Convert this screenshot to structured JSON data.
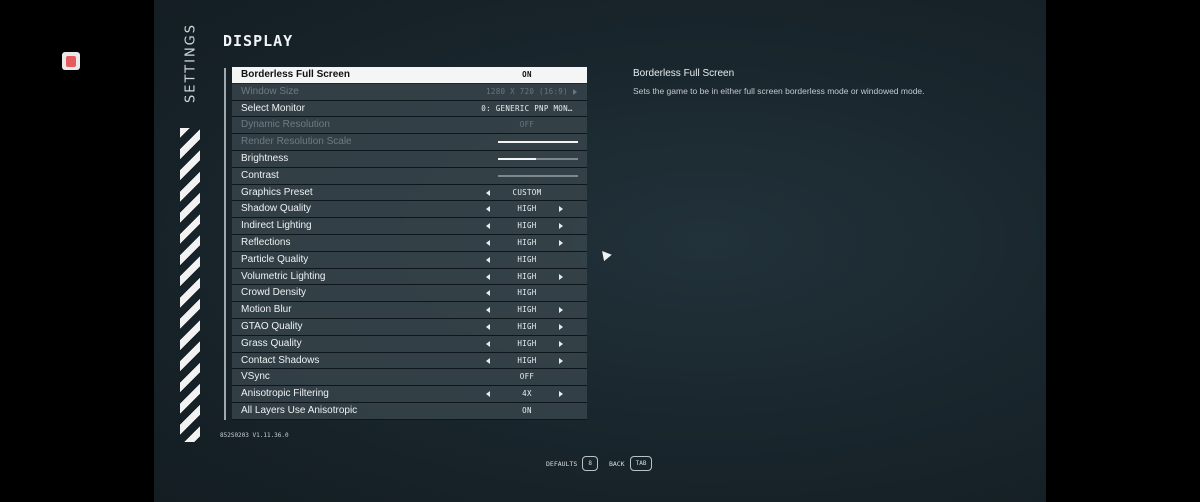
{
  "header": {
    "title": "DISPLAY",
    "section": "SETTINGS"
  },
  "settings": [
    {
      "label": "Borderless Full Screen",
      "value": "ON",
      "kind": "value",
      "state": "selected"
    },
    {
      "label": "Window Size",
      "value": "1280 X 720 (16:9)",
      "kind": "value-right",
      "state": "disabled"
    },
    {
      "label": "Select Monitor",
      "value": "0: GENERIC PNP MON…",
      "kind": "value-wide",
      "state": "normal"
    },
    {
      "label": "Dynamic Resolution",
      "value": "OFF",
      "kind": "value",
      "state": "disabled"
    },
    {
      "label": "Render Resolution Scale",
      "kind": "slider",
      "level": 1.0,
      "state": "disabled"
    },
    {
      "label": "Brightness",
      "kind": "slider",
      "level": 0.47,
      "state": "normal"
    },
    {
      "label": "Contrast",
      "kind": "slider",
      "level": 0.0,
      "state": "normal"
    },
    {
      "label": "Graphics Preset",
      "value": "CUSTOM",
      "kind": "left",
      "state": "normal"
    },
    {
      "label": "Shadow Quality",
      "value": "HIGH",
      "kind": "both",
      "state": "normal"
    },
    {
      "label": "Indirect Lighting",
      "value": "HIGH",
      "kind": "both",
      "state": "normal"
    },
    {
      "label": "Reflections",
      "value": "HIGH",
      "kind": "both",
      "state": "normal"
    },
    {
      "label": "Particle Quality",
      "value": "HIGH",
      "kind": "left",
      "state": "normal"
    },
    {
      "label": "Volumetric Lighting",
      "value": "HIGH",
      "kind": "both",
      "state": "normal"
    },
    {
      "label": "Crowd Density",
      "value": "HIGH",
      "kind": "left",
      "state": "normal"
    },
    {
      "label": "Motion Blur",
      "value": "HIGH",
      "kind": "both",
      "state": "normal"
    },
    {
      "label": "GTAO Quality",
      "value": "HIGH",
      "kind": "both",
      "state": "normal"
    },
    {
      "label": "Grass Quality",
      "value": "HIGH",
      "kind": "both",
      "state": "normal"
    },
    {
      "label": "Contact Shadows",
      "value": "HIGH",
      "kind": "both",
      "state": "normal"
    },
    {
      "label": "VSync",
      "value": "OFF",
      "kind": "value",
      "state": "normal"
    },
    {
      "label": "Anisotropic Filtering",
      "value": "4X",
      "kind": "both",
      "state": "normal"
    },
    {
      "label": "All Layers Use Anisotropic",
      "value": "ON",
      "kind": "value",
      "state": "normal"
    }
  ],
  "detail": {
    "title": "Borderless Full Screen",
    "description": "Sets the game to be in either full screen borderless mode or windowed mode."
  },
  "build": "852S0203 V1.11.36.0",
  "footer": {
    "defaults_label": "DEFAULTS",
    "defaults_key": "8",
    "back_label": "BACK",
    "back_key": "TAB"
  },
  "icons": {
    "arrow_left": "arrow-left-icon",
    "arrow_right": "arrow-right-icon",
    "cursor": "mouse-cursor-icon"
  },
  "colors": {
    "selected_row": "#f4f5f5",
    "row": "#3a464d",
    "background": "#1a272e",
    "hazard": "#f2f2f2"
  }
}
